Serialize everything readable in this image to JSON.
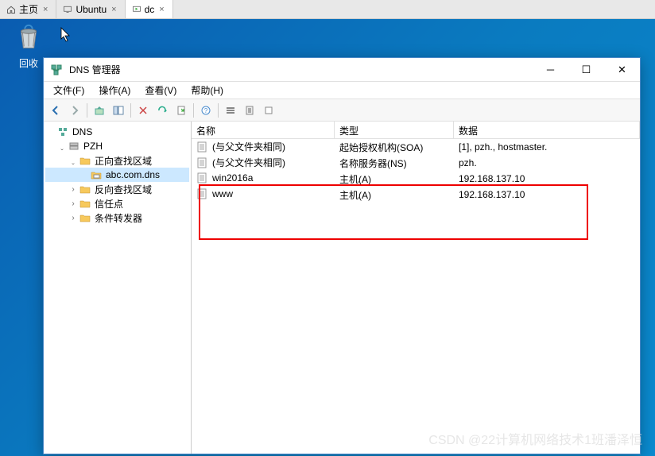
{
  "tabs": [
    {
      "label": "主页",
      "active": false
    },
    {
      "label": "Ubuntu",
      "active": false
    },
    {
      "label": "dc",
      "active": true
    }
  ],
  "desktop": {
    "recycle_bin": "回收"
  },
  "window": {
    "title": "DNS 管理器",
    "menu": {
      "file": "文件(F)",
      "action": "操作(A)",
      "view": "查看(V)",
      "help": "帮助(H)"
    },
    "tree": {
      "root": "DNS",
      "server": "PZH",
      "forward": "正向查找区域",
      "zone": "abc.com.dns",
      "reverse": "反向查找区域",
      "trust": "信任点",
      "conditional": "条件转发器"
    },
    "columns": {
      "name": "名称",
      "type": "类型",
      "data": "数据"
    },
    "records": [
      {
        "name": "(与父文件夹相同)",
        "type": "起始授权机构(SOA)",
        "data": "[1], pzh., hostmaster."
      },
      {
        "name": "(与父文件夹相同)",
        "type": "名称服务器(NS)",
        "data": "pzh."
      },
      {
        "name": "win2016a",
        "type": "主机(A)",
        "data": "192.168.137.10"
      },
      {
        "name": "www",
        "type": "主机(A)",
        "data": "192.168.137.10"
      }
    ]
  },
  "watermark": "CSDN @22计算机网络技术1班潘泽恒"
}
